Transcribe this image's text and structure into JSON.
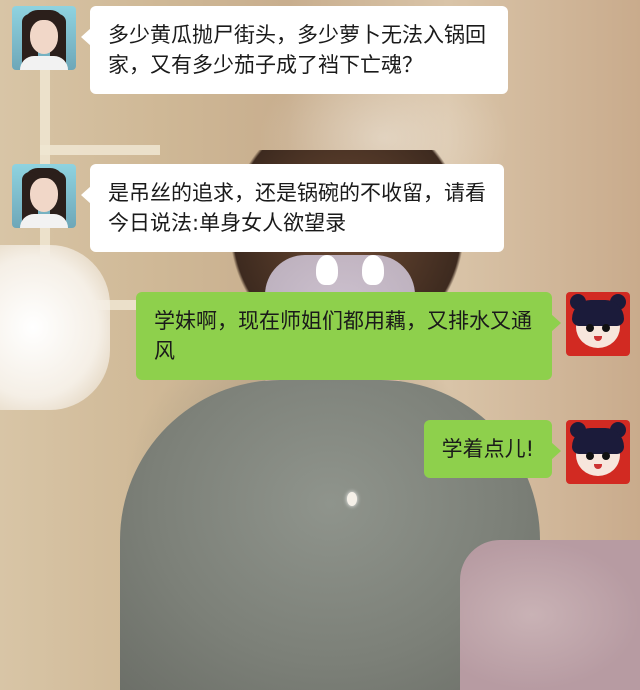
{
  "chat": {
    "messages": [
      {
        "side": "left",
        "sender": "girl",
        "text": "多少黄瓜抛尸街头，多少萝卜无法入锅回家，又有多少茄子成了裆下亡魂？"
      },
      {
        "side": "left",
        "sender": "girl",
        "text": "是吊丝的追求，还是锅碗的不收留，请看今日说法:单身女人欲望录"
      },
      {
        "side": "right",
        "sender": "toon",
        "text": "学妹啊，现在师姐们都用藕，又排水又通风"
      },
      {
        "side": "right",
        "sender": "toon",
        "text": "学着点儿!"
      }
    ]
  },
  "colors": {
    "left_bubble": "#ffffff",
    "right_bubble": "#8ed04c",
    "toon_avatar_bg": "#d22a22"
  }
}
